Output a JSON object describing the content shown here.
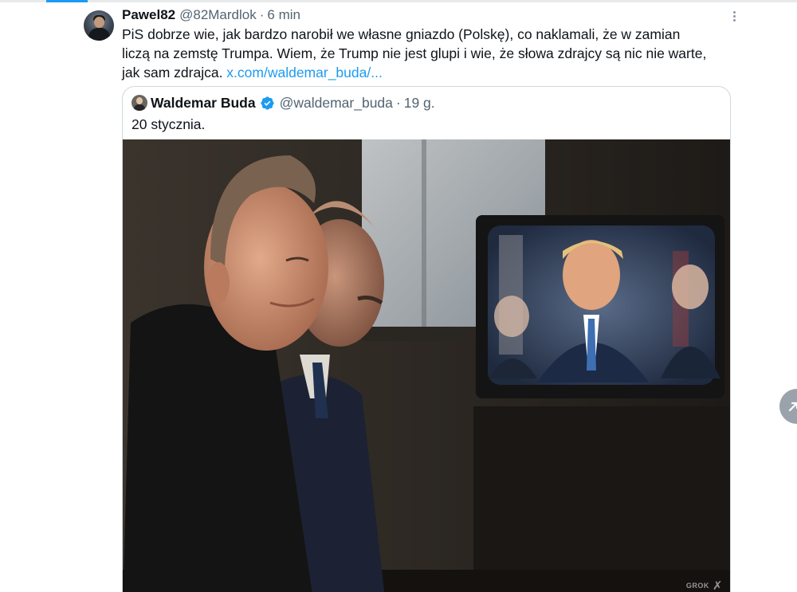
{
  "tweet": {
    "display_name": "Pawel82",
    "handle": "@82Mardlok",
    "separator": "·",
    "time": "6 min",
    "text_line1": "PiS dobrze wie, jak bardzo narobił we własne gniazdo (Polskę), co naklamali, że w zamian",
    "text_line2": "liczą na zemstę Trumpa. Wiem, że Trump nie jest glupi i wie, że słowa zdrajcy są nic nie warte,",
    "text_line3": "jak sam zdrajca. ",
    "link": "x.com/waldemar_buda/..."
  },
  "quote": {
    "display_name": "Waldemar Buda",
    "handle": "@waldemar_buda",
    "separator": "·",
    "time": "19 g.",
    "text": "20 stycznia.",
    "image_watermark": "GROK",
    "verified_color": "#1d9bf0"
  },
  "icons": {
    "more": "more-dots-icon",
    "verified": "verified-badge-icon",
    "scroll": "arrow-up-icon"
  },
  "colors": {
    "accent": "#1d9bf0",
    "secondary_text": "#536471",
    "border": "#cfd9de"
  }
}
